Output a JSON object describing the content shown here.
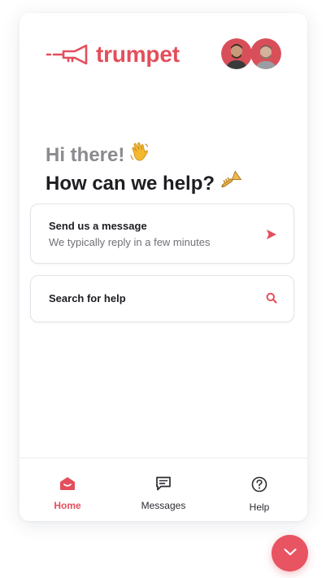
{
  "brand": {
    "name": "trumpet",
    "color": "#e34f5c"
  },
  "header": {
    "avatars": [
      "agent-avatar",
      "agent-avatar"
    ]
  },
  "greeting": {
    "line1": "Hi there!",
    "line1_emoji": "👋",
    "line2": "How can we help?",
    "line2_emoji": "🎺"
  },
  "cards": {
    "message": {
      "title": "Send us a message",
      "subtitle": "We typically reply in a few minutes",
      "icon": "send-icon"
    },
    "search": {
      "title": "Search for help",
      "icon": "search-icon"
    }
  },
  "nav": {
    "items": [
      {
        "label": "Home",
        "icon": "home-icon",
        "active": true
      },
      {
        "label": "Messages",
        "icon": "messages-icon",
        "active": false
      },
      {
        "label": "Help",
        "icon": "help-icon",
        "active": false
      }
    ]
  },
  "launcher": {
    "icon": "chevron-down-icon",
    "color": "#e85462"
  }
}
